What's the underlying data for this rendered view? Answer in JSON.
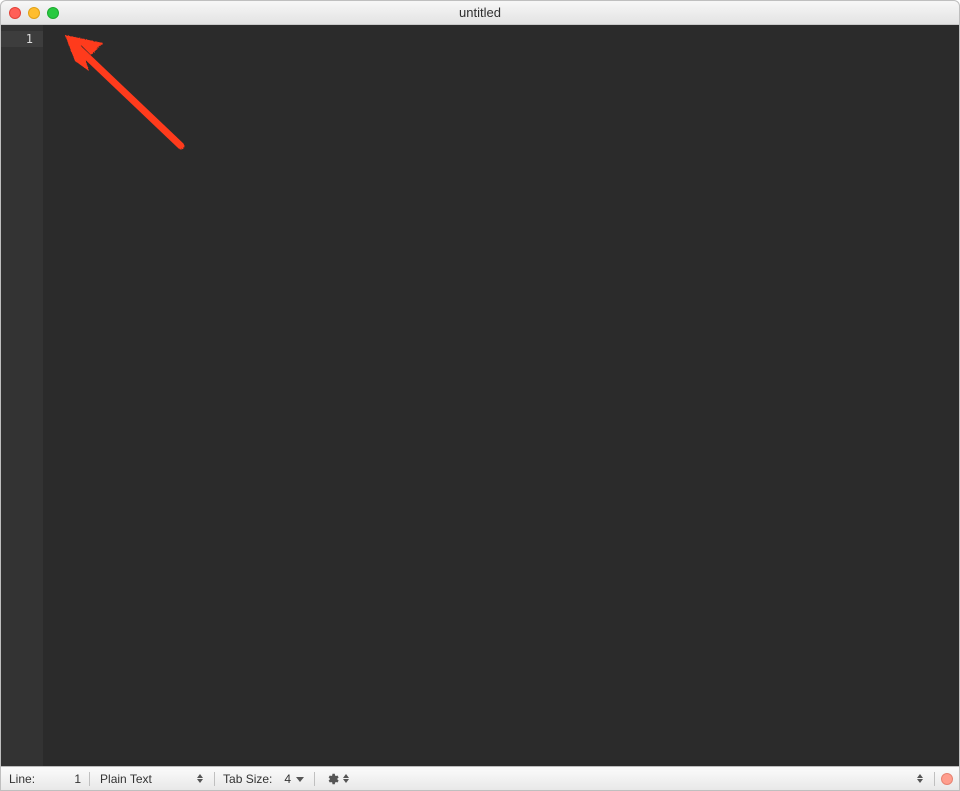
{
  "window": {
    "title": "untitled"
  },
  "editor": {
    "line_numbers": [
      "1"
    ]
  },
  "statusbar": {
    "line_label": "Line:",
    "line_value": "1",
    "syntax": "Plain Text",
    "tabsize_label": "Tab Size:",
    "tabsize_value": "4"
  },
  "annotation": {
    "type": "arrow",
    "color": "#ff3b1f",
    "description": "hand-drawn arrow pointing to top-left corner"
  }
}
